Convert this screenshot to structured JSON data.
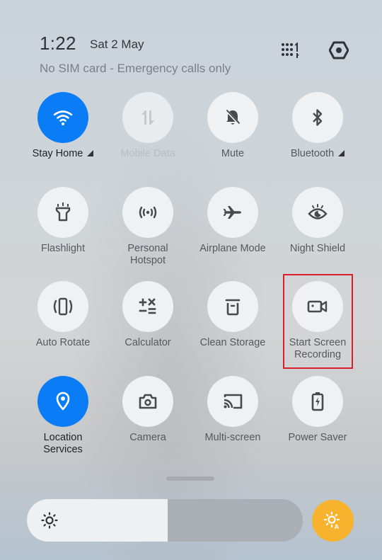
{
  "status": {
    "time": "1:22",
    "date": "Sat 2 May",
    "carrier": "No SIM card - Emergency calls only"
  },
  "header_icons": [
    {
      "name": "edit-tiles-grid-icon"
    },
    {
      "name": "settings-icon"
    }
  ],
  "tiles": [
    {
      "label": "Stay Home",
      "icon": "wifi-icon",
      "state": "on",
      "expandable": true
    },
    {
      "label": "Mobile Data",
      "icon": "mobile-data-icon",
      "state": "disabled",
      "expandable": false
    },
    {
      "label": "Mute",
      "icon": "bell-off-icon",
      "state": "off",
      "expandable": false
    },
    {
      "label": "Bluetooth",
      "icon": "bluetooth-icon",
      "state": "off",
      "expandable": true
    },
    {
      "label": "Flashlight",
      "icon": "flashlight-icon",
      "state": "off"
    },
    {
      "label": "Personal Hotspot",
      "icon": "hotspot-icon",
      "state": "off"
    },
    {
      "label": "Airplane Mode",
      "icon": "airplane-icon",
      "state": "off"
    },
    {
      "label": "Night Shield",
      "icon": "eye-icon",
      "state": "off"
    },
    {
      "label": "Auto Rotate",
      "icon": "auto-rotate-icon",
      "state": "off"
    },
    {
      "label": "Calculator",
      "icon": "calculator-icon",
      "state": "off"
    },
    {
      "label": "Clean Storage",
      "icon": "trash-icon",
      "state": "off"
    },
    {
      "label": "Start Screen Recording",
      "label_lines": [
        "Start Screen",
        "Recording"
      ],
      "icon": "video-camera-icon",
      "state": "off",
      "highlighted": true
    },
    {
      "label": "Location Services",
      "label_lines": [
        "Location",
        "Services"
      ],
      "icon": "location-pin-icon",
      "state": "on"
    },
    {
      "label": "Camera",
      "icon": "camera-icon",
      "state": "off"
    },
    {
      "label": "Multi-screen",
      "icon": "cast-icon",
      "state": "off"
    },
    {
      "label": "Power Saver",
      "icon": "battery-saver-icon",
      "state": "off"
    }
  ],
  "personal_hotspot_lines": [
    "Personal",
    "Hotspot"
  ],
  "brightness": {
    "level_percent": 51,
    "auto_brightness": "on"
  },
  "colors": {
    "accent_on": "#0a7cf5",
    "auto_brightness": "#f7b32d",
    "highlight_box": "#d9202a"
  }
}
